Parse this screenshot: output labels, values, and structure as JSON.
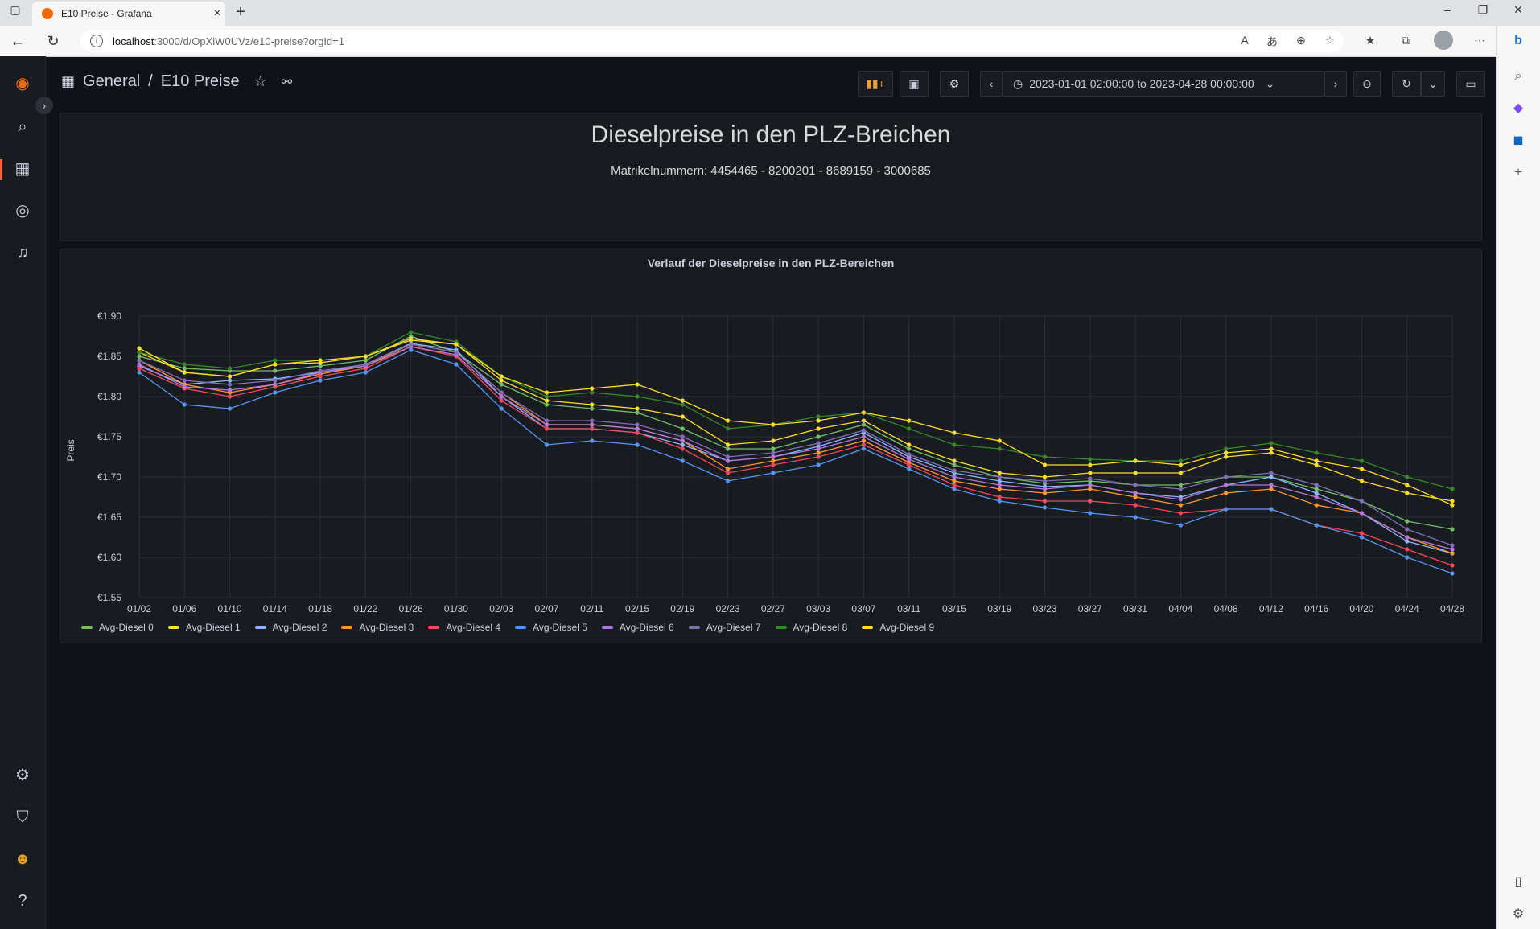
{
  "browser": {
    "tab_title": "E10 Preise - Grafana",
    "url_host": "localhost",
    "url_path": ":3000/d/OpXiW0UVz/e10-preise?orgId=1"
  },
  "breadcrumb": {
    "folder": "General",
    "separator": "/",
    "dashboard": "E10 Preise"
  },
  "time_range": "2023-01-01 02:00:00 to 2023-04-28 00:00:00",
  "text_panel": {
    "heading": "Dieselpreise in den PLZ-Breichen",
    "subheading": "Matrikelnummern: 4454465 - 8200201 - 8689159 - 3000685"
  },
  "chart_data": {
    "type": "line",
    "title": "Verlauf der Dieselpreise in den PLZ-Bereichen",
    "ylabel": "Preis",
    "ylim": [
      1.55,
      1.9
    ],
    "yticks": [
      "€1.90",
      "€1.85",
      "€1.80",
      "€1.75",
      "€1.70",
      "€1.65",
      "€1.60",
      "€1.55"
    ],
    "xticks": [
      "01/02",
      "01/06",
      "01/10",
      "01/14",
      "01/18",
      "01/22",
      "01/26",
      "01/30",
      "02/03",
      "02/07",
      "02/11",
      "02/15",
      "02/19",
      "02/23",
      "02/27",
      "03/03",
      "03/07",
      "03/11",
      "03/15",
      "03/19",
      "03/23",
      "03/27",
      "03/31",
      "04/04",
      "04/08",
      "04/12",
      "04/16",
      "04/20",
      "04/24",
      "04/28"
    ],
    "grid": true,
    "legend": "bottom-left",
    "x_days": [
      0,
      4,
      8,
      12,
      16,
      20,
      24,
      28,
      32,
      36,
      40,
      44,
      48,
      52,
      56,
      60,
      64,
      68,
      72,
      76,
      80,
      84,
      88,
      92,
      96,
      100,
      104,
      108,
      112,
      116
    ],
    "series": [
      {
        "name": "Avg-Diesel 0",
        "color": "#73bf69",
        "values": [
          1.85,
          1.835,
          1.832,
          1.832,
          1.838,
          1.845,
          1.875,
          1.855,
          1.815,
          1.79,
          1.785,
          1.78,
          1.76,
          1.735,
          1.735,
          1.75,
          1.765,
          1.735,
          1.715,
          1.7,
          1.692,
          1.695,
          1.69,
          1.69,
          1.7,
          1.7,
          1.685,
          1.67,
          1.645,
          1.635
        ]
      },
      {
        "name": "Avg-Diesel 1",
        "color": "#fade2a",
        "values": [
          1.855,
          1.83,
          1.825,
          1.84,
          1.842,
          1.85,
          1.87,
          1.865,
          1.82,
          1.795,
          1.79,
          1.785,
          1.775,
          1.74,
          1.745,
          1.76,
          1.77,
          1.74,
          1.72,
          1.705,
          1.7,
          1.705,
          1.705,
          1.705,
          1.725,
          1.73,
          1.715,
          1.695,
          1.68,
          1.67
        ]
      },
      {
        "name": "Avg-Diesel 2",
        "color": "#8ab8ff",
        "values": [
          1.838,
          1.815,
          1.82,
          1.822,
          1.83,
          1.84,
          1.866,
          1.858,
          1.8,
          1.76,
          1.76,
          1.755,
          1.74,
          1.72,
          1.725,
          1.738,
          1.755,
          1.725,
          1.705,
          1.695,
          1.688,
          1.69,
          1.68,
          1.675,
          1.69,
          1.7,
          1.68,
          1.655,
          1.62,
          1.605
        ]
      },
      {
        "name": "Avg-Diesel 3",
        "color": "#ff9830",
        "values": [
          1.845,
          1.815,
          1.805,
          1.815,
          1.828,
          1.838,
          1.865,
          1.855,
          1.805,
          1.765,
          1.765,
          1.76,
          1.745,
          1.71,
          1.72,
          1.73,
          1.745,
          1.718,
          1.695,
          1.685,
          1.68,
          1.685,
          1.675,
          1.665,
          1.68,
          1.685,
          1.665,
          1.655,
          1.625,
          1.605
        ]
      },
      {
        "name": "Avg-Diesel 4",
        "color": "#f2495c",
        "values": [
          1.835,
          1.81,
          1.8,
          1.812,
          1.825,
          1.835,
          1.862,
          1.85,
          1.795,
          1.76,
          1.76,
          1.755,
          1.735,
          1.705,
          1.715,
          1.725,
          1.74,
          1.715,
          1.69,
          1.675,
          1.67,
          1.67,
          1.665,
          1.655,
          1.66,
          1.66,
          1.64,
          1.63,
          1.61,
          1.59
        ]
      },
      {
        "name": "Avg-Diesel 5",
        "color": "#5794f2",
        "values": [
          1.83,
          1.79,
          1.785,
          1.805,
          1.82,
          1.83,
          1.858,
          1.84,
          1.785,
          1.74,
          1.745,
          1.74,
          1.72,
          1.695,
          1.705,
          1.715,
          1.735,
          1.71,
          1.685,
          1.67,
          1.662,
          1.655,
          1.65,
          1.64,
          1.66,
          1.66,
          1.64,
          1.625,
          1.6,
          1.58
        ]
      },
      {
        "name": "Avg-Diesel 6",
        "color": "#b877d9",
        "values": [
          1.84,
          1.812,
          1.808,
          1.815,
          1.83,
          1.838,
          1.862,
          1.852,
          1.8,
          1.765,
          1.765,
          1.76,
          1.745,
          1.72,
          1.725,
          1.735,
          1.75,
          1.722,
          1.7,
          1.69,
          1.685,
          1.69,
          1.68,
          1.672,
          1.69,
          1.69,
          1.675,
          1.655,
          1.625,
          1.61
        ]
      },
      {
        "name": "Avg-Diesel 7",
        "color": "#806eb7",
        "values": [
          1.845,
          1.82,
          1.815,
          1.82,
          1.832,
          1.84,
          1.865,
          1.855,
          1.805,
          1.77,
          1.77,
          1.765,
          1.75,
          1.725,
          1.73,
          1.742,
          1.758,
          1.728,
          1.708,
          1.7,
          1.695,
          1.698,
          1.69,
          1.685,
          1.7,
          1.705,
          1.69,
          1.67,
          1.635,
          1.615
        ]
      },
      {
        "name": "Avg-Diesel 8",
        "color": "#37872d",
        "values": [
          1.855,
          1.84,
          1.835,
          1.845,
          1.845,
          1.85,
          1.88,
          1.868,
          1.825,
          1.8,
          1.805,
          1.8,
          1.79,
          1.76,
          1.765,
          1.775,
          1.78,
          1.76,
          1.74,
          1.735,
          1.725,
          1.722,
          1.72,
          1.72,
          1.735,
          1.742,
          1.73,
          1.72,
          1.7,
          1.685
        ]
      },
      {
        "name": "Avg-Diesel 9",
        "color": "#fade2a",
        "values": [
          1.86,
          1.83,
          1.825,
          1.84,
          1.845,
          1.85,
          1.872,
          1.865,
          1.825,
          1.805,
          1.81,
          1.815,
          1.795,
          1.77,
          1.765,
          1.77,
          1.78,
          1.77,
          1.755,
          1.745,
          1.715,
          1.715,
          1.72,
          1.715,
          1.73,
          1.735,
          1.72,
          1.71,
          1.69,
          1.665
        ]
      }
    ]
  }
}
